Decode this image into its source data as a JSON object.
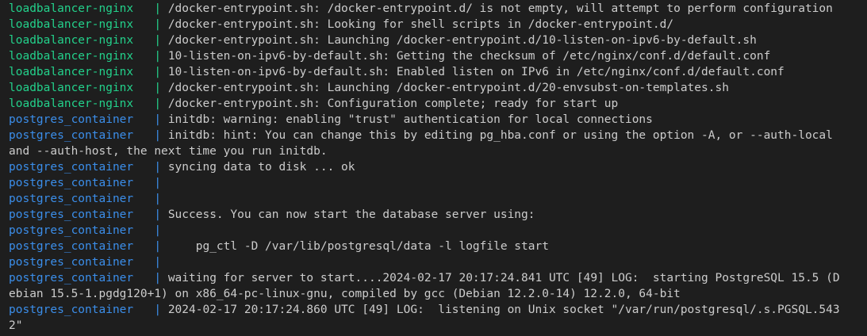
{
  "colors": {
    "background": "#1e1e1e",
    "text": "#cccccc",
    "loadbalancer": "#23d18b",
    "postgres": "#3b8eea"
  },
  "lines": [
    {
      "service": "loadbalancer-nginx  ",
      "color": "#23d18b",
      "sep": " | ",
      "msg": "/docker-entrypoint.sh: /docker-entrypoint.d/ is not empty, will attempt to perform configuration"
    },
    {
      "service": "loadbalancer-nginx  ",
      "color": "#23d18b",
      "sep": " | ",
      "msg": "/docker-entrypoint.sh: Looking for shell scripts in /docker-entrypoint.d/"
    },
    {
      "service": "loadbalancer-nginx  ",
      "color": "#23d18b",
      "sep": " | ",
      "msg": "/docker-entrypoint.sh: Launching /docker-entrypoint.d/10-listen-on-ipv6-by-default.sh"
    },
    {
      "service": "loadbalancer-nginx  ",
      "color": "#23d18b",
      "sep": " | ",
      "msg": "10-listen-on-ipv6-by-default.sh: Getting the checksum of /etc/nginx/conf.d/default.conf"
    },
    {
      "service": "loadbalancer-nginx  ",
      "color": "#23d18b",
      "sep": " | ",
      "msg": "10-listen-on-ipv6-by-default.sh: Enabled listen on IPv6 in /etc/nginx/conf.d/default.conf"
    },
    {
      "service": "loadbalancer-nginx  ",
      "color": "#23d18b",
      "sep": " | ",
      "msg": "/docker-entrypoint.sh: Launching /docker-entrypoint.d/20-envsubst-on-templates.sh"
    },
    {
      "service": "loadbalancer-nginx  ",
      "color": "#23d18b",
      "sep": " | ",
      "msg": "/docker-entrypoint.sh: Configuration complete; ready for start up"
    },
    {
      "service": "postgres_container  ",
      "color": "#3b8eea",
      "sep": " | ",
      "msg": "initdb: warning: enabling \"trust\" authentication for local connections"
    },
    {
      "service": "postgres_container  ",
      "color": "#3b8eea",
      "sep": " | ",
      "msg": "initdb: hint: You can change this by editing pg_hba.conf or using the option -A, or --auth-local"
    },
    {
      "service": "",
      "color": "#cccccc",
      "sep": "",
      "msg": "and --auth-host, the next time you run initdb."
    },
    {
      "service": "postgres_container  ",
      "color": "#3b8eea",
      "sep": " | ",
      "msg": "syncing data to disk ... ok"
    },
    {
      "service": "postgres_container  ",
      "color": "#3b8eea",
      "sep": " | ",
      "msg": ""
    },
    {
      "service": "postgres_container  ",
      "color": "#3b8eea",
      "sep": " | ",
      "msg": ""
    },
    {
      "service": "postgres_container  ",
      "color": "#3b8eea",
      "sep": " | ",
      "msg": "Success. You can now start the database server using:"
    },
    {
      "service": "postgres_container  ",
      "color": "#3b8eea",
      "sep": " | ",
      "msg": ""
    },
    {
      "service": "postgres_container  ",
      "color": "#3b8eea",
      "sep": " | ",
      "msg": "    pg_ctl -D /var/lib/postgresql/data -l logfile start"
    },
    {
      "service": "postgres_container  ",
      "color": "#3b8eea",
      "sep": " | ",
      "msg": ""
    },
    {
      "service": "postgres_container  ",
      "color": "#3b8eea",
      "sep": " | ",
      "msg": "waiting for server to start....2024-02-17 20:17:24.841 UTC [49] LOG:  starting PostgreSQL 15.5 (D"
    },
    {
      "service": "",
      "color": "#cccccc",
      "sep": "",
      "msg": "ebian 15.5-1.pgdg120+1) on x86_64-pc-linux-gnu, compiled by gcc (Debian 12.2.0-14) 12.2.0, 64-bit"
    },
    {
      "service": "postgres_container  ",
      "color": "#3b8eea",
      "sep": " | ",
      "msg": "2024-02-17 20:17:24.860 UTC [49] LOG:  listening on Unix socket \"/var/run/postgresql/.s.PGSQL.543"
    },
    {
      "service": "",
      "color": "#cccccc",
      "sep": "",
      "msg": "2\""
    }
  ]
}
